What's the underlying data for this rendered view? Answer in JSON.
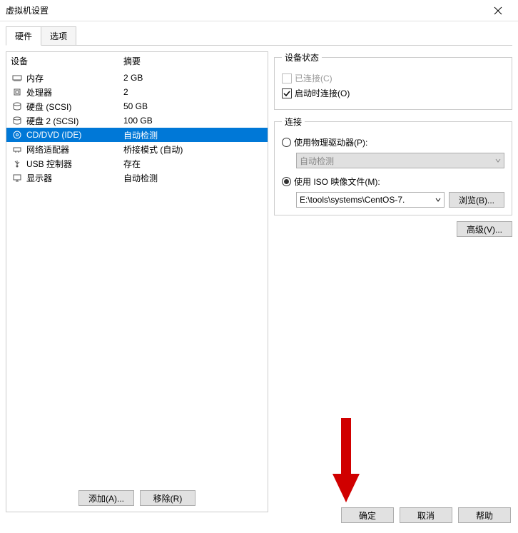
{
  "window": {
    "title": "虚拟机设置"
  },
  "tabs": {
    "hardware": "硬件",
    "options": "选项"
  },
  "hw_table": {
    "header_device": "设备",
    "header_summary": "摘要",
    "rows": [
      {
        "icon": "memory",
        "name": "内存",
        "summary": "2 GB",
        "selected": false
      },
      {
        "icon": "cpu",
        "name": "处理器",
        "summary": "2",
        "selected": false
      },
      {
        "icon": "disk",
        "name": "硬盘 (SCSI)",
        "summary": "50 GB",
        "selected": false
      },
      {
        "icon": "disk",
        "name": "硬盘 2 (SCSI)",
        "summary": "100 GB",
        "selected": false
      },
      {
        "icon": "cd",
        "name": "CD/DVD (IDE)",
        "summary": "自动检测",
        "selected": true
      },
      {
        "icon": "net",
        "name": "网络适配器",
        "summary": "桥接模式 (自动)",
        "selected": false
      },
      {
        "icon": "usb",
        "name": "USB 控制器",
        "summary": "存在",
        "selected": false
      },
      {
        "icon": "display",
        "name": "显示器",
        "summary": "自动检测",
        "selected": false
      }
    ],
    "add_btn": "添加(A)...",
    "remove_btn": "移除(R)"
  },
  "device_status": {
    "legend": "设备状态",
    "connected": "已连接(C)",
    "connect_at_poweron": "启动时连接(O)",
    "connected_checked": false,
    "connected_enabled": false,
    "poweron_checked": true
  },
  "connection": {
    "legend": "连接",
    "use_physical": "使用物理驱动器(P):",
    "physical_value": "自动检测",
    "use_iso": "使用 ISO 映像文件(M):",
    "iso_value": "E:\\tools\\systems\\CentOS-7.",
    "browse_btn": "浏览(B)...",
    "selected": "iso"
  },
  "advanced_btn": "高级(V)...",
  "dialog_buttons": {
    "ok": "确定",
    "cancel": "取消",
    "help": "帮助"
  }
}
